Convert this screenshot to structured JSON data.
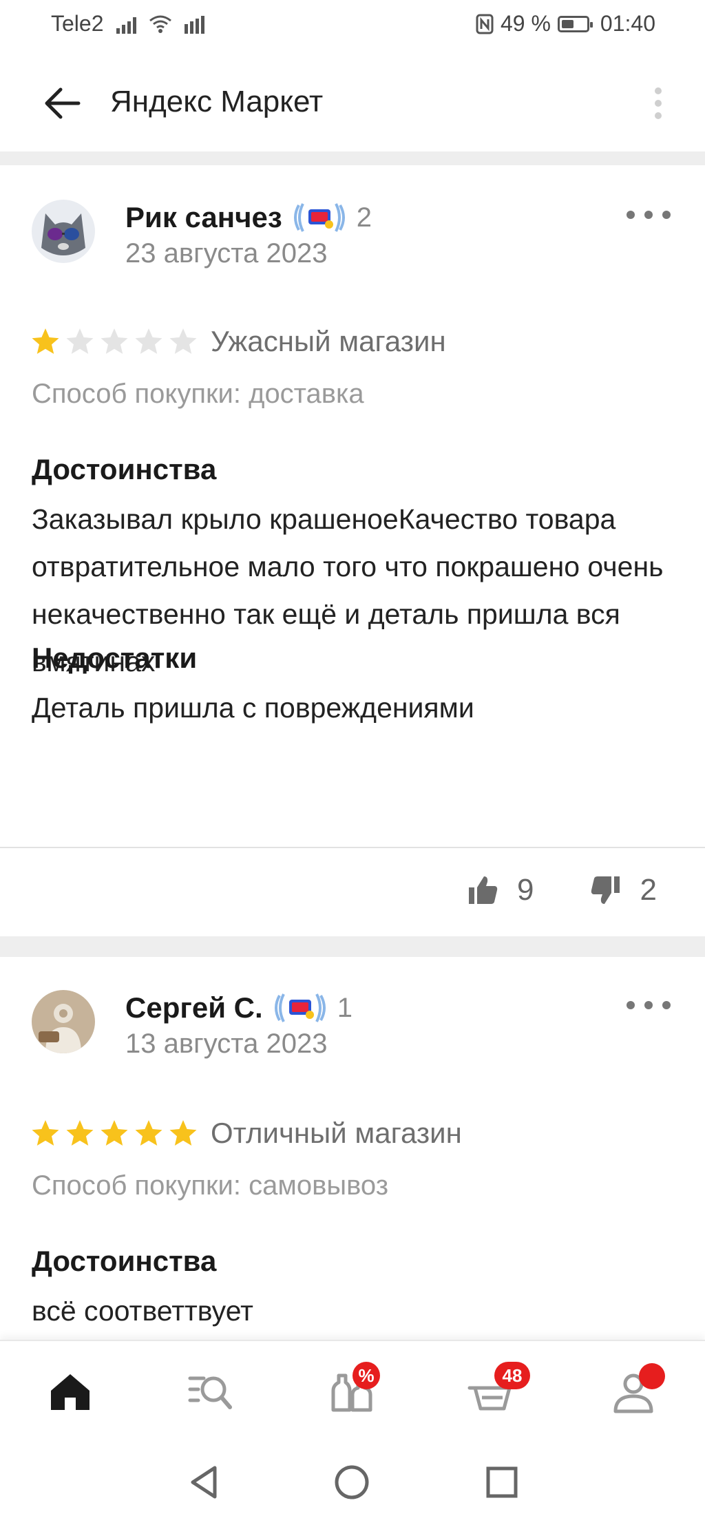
{
  "status_bar": {
    "carrier": "Tele2",
    "battery": "49 %",
    "battery_level": 0.49,
    "time": "01:40"
  },
  "app_bar": {
    "title": "Яндекс Маркет",
    "back_icon": "arrow-left-icon",
    "menu_icon": "more-vertical-icon"
  },
  "reviews": [
    {
      "author": "Рик санчез",
      "review_count": "2",
      "date": "23 августа 2023",
      "rating": 1,
      "max_rating": 5,
      "rating_text": "Ужасный магазин",
      "purchase_method": "Способ покупки: доставка",
      "pros_title": "Достоинства",
      "pros_text": "Заказывал крыло крашеноеКачество товара отвратительное мало того что покрашено очень некачественно так ещё и деталь пришла вся вмятинах",
      "cons_title": "Недостатки",
      "cons_text": "Деталь пришла с повреждениями",
      "likes": "9",
      "dislikes": "2"
    },
    {
      "author": "Сергей С.",
      "review_count": "1",
      "date": "13 августа 2023",
      "rating": 5,
      "max_rating": 5,
      "rating_text": "Отличный магазин",
      "purchase_method": "Способ покупки: самовывоз",
      "pros_title": "Достоинства",
      "pros_text": "всё соответтвует"
    }
  ],
  "bottom_nav": {
    "items": [
      {
        "icon": "home-icon",
        "active": true
      },
      {
        "icon": "catalog-search-icon"
      },
      {
        "icon": "discount-bottles-icon",
        "badge": "%"
      },
      {
        "icon": "cart-icon",
        "badge": "48"
      },
      {
        "icon": "profile-icon",
        "dot": true
      }
    ]
  },
  "colors": {
    "star_filled": "#f8c21c",
    "star_empty": "#e4e4e4",
    "badge_red": "#e61e1e",
    "text_secondary": "#8a8a8a"
  }
}
